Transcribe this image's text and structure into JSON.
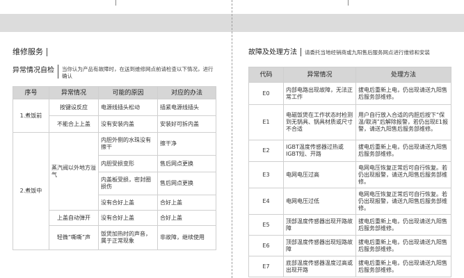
{
  "left": {
    "section_title": "维修服务",
    "subsection_title": "异常情况自检",
    "subsection_note": "当你认为产品有故障时，在送到维修网点前请检查以下情况，进行确认",
    "headers": [
      "序号",
      "异常情况",
      "可能的原因",
      "对应的办法"
    ],
    "groups": [
      {
        "no": "1.煮饭前",
        "rows": [
          {
            "symptom": "按键设反应",
            "cause": "电源线插头松动",
            "remedy": "插紧电源线插头"
          },
          {
            "symptom": "不能合上上盖",
            "cause": "没有安装内盖",
            "remedy": "安装好可拆内盖"
          }
        ]
      },
      {
        "no": "2.煮饭中",
        "rows": [
          {
            "symptom": "蒸汽阀以外地方溢气",
            "cause": "内胆外侧的水珠没有擦干",
            "remedy": "擦干净"
          },
          {
            "cause": "内胆受损变形",
            "remedy": "售后网点更换"
          },
          {
            "cause": "内盖板受损，密封圈损伤",
            "remedy": "售后网点更换"
          },
          {
            "cause": "没有合好上盖",
            "remedy": "合好上盖"
          },
          {
            "symptom": "上盖自动弹开",
            "cause": "没有合好上盖",
            "remedy": "合好上盖"
          },
          {
            "symptom": "轻微“嘶嘶”声",
            "cause": "饭煲加热时的声音，属于正常现象",
            "remedy": "非故障，继续使用"
          }
        ]
      }
    ]
  },
  "right": {
    "section_title": "故障及处理方法",
    "note": "请委托当地经销商或九阳售后服务网点进行维修和安装",
    "headers": [
      "代码",
      "异常情况",
      "处理方法"
    ],
    "rows": [
      {
        "code": "E0",
        "symptom": "内部电路出现故障，无法正常工作",
        "remedy": "拔电后重新上电，仍出现请送九阳售后服务部维修。"
      },
      {
        "code": "E1",
        "symptom": "电磁饭煲在工作状态时检测到无锅具、锅具材质或尺寸不合适",
        "remedy": "用户自行放入合适的内胆后按下“保温/取消”后解除报警，若仍出现E1报警，请送九阳售后服务部维修。"
      },
      {
        "code": "E2",
        "symptom": "IGBT温度传感器过热或IGBT短、开路",
        "remedy": "拔电后重新上电，仍出现请送九阳售后服务部维修。"
      },
      {
        "code": "E3",
        "symptom": "电网电压过高",
        "remedy": "电网电压恢复正常后可自行恢复。若仍出现报警，请送九阳售后服务部维修。"
      },
      {
        "code": "E4",
        "symptom": "电网电压过低",
        "remedy": "电网电压恢复正常后可自行恢复。若仍出现报警，请送九阳售后服务部维修。"
      },
      {
        "code": "E5",
        "symptom": "顶部温度传感器出现开路故障",
        "remedy": "拔电后重新上电，仍出现请送九阳售后服务部维修。"
      },
      {
        "code": "E6",
        "symptom": "顶部温度传感器出现短路故障",
        "remedy": "拔电后重新上电，仍出现请送九阳售后服务部维修。"
      },
      {
        "code": "E7",
        "symptom": "底部温度传感器温度过高或出现开路",
        "remedy": "拔电后重新上电，仍出现请送九阳售后服务部维修。"
      }
    ]
  }
}
